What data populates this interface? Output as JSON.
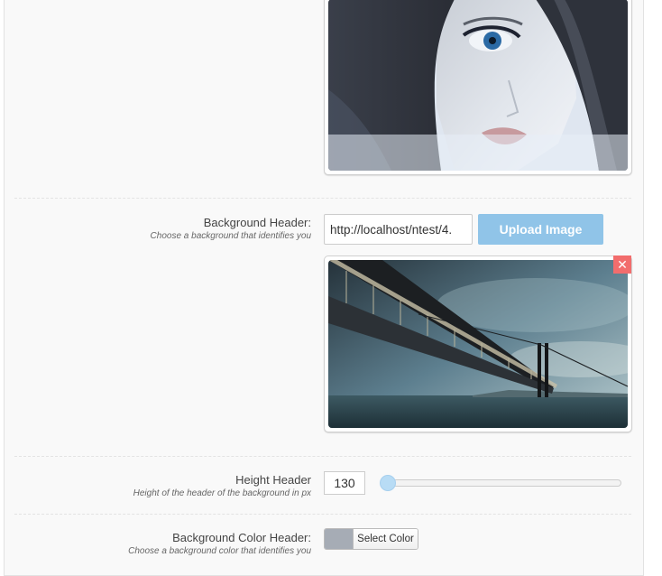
{
  "colors": {
    "accent": "#90c4e8",
    "remove": "#f26d6d",
    "slider_handle": "#b8dcf5",
    "swatch": "#a6acb5"
  },
  "profile_image": {
    "description_icon": "portrait-image"
  },
  "background_header": {
    "label": "Background Header:",
    "description": "Choose a background that identifies you",
    "url_value": "http://localhost/ntest/4.",
    "upload_label": "Upload Image",
    "remove_icon": "close-icon",
    "remove_glyph": "✕"
  },
  "height_header": {
    "label": "Height Header",
    "description": "Height of the header of the background in px",
    "value": "130",
    "slider_min": 130,
    "slider_max": 500,
    "slider_value": 130
  },
  "background_color_header": {
    "label": "Background Color Header:",
    "description": "Choose a background color that identifies you",
    "button_label": "Select Color"
  }
}
